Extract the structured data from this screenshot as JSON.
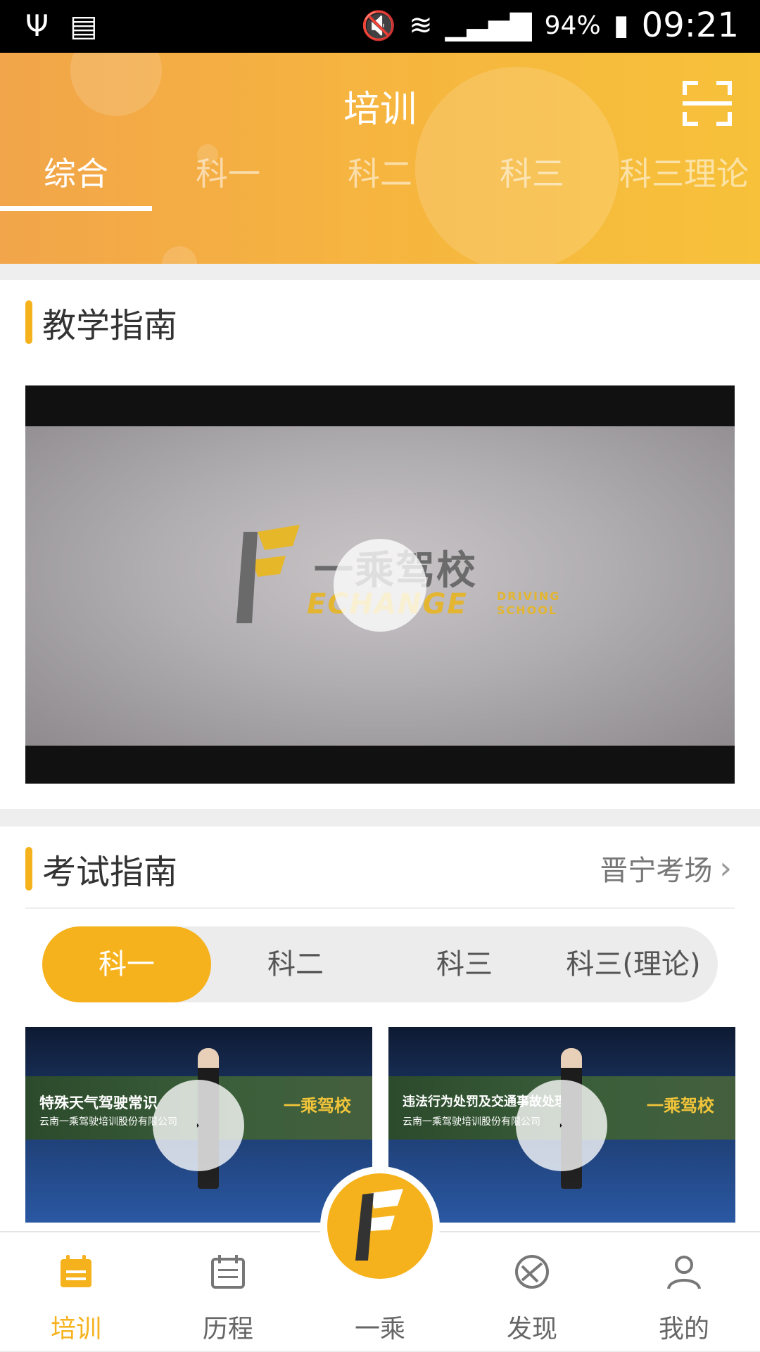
{
  "status_bar": {
    "battery": "94%",
    "time": "09:21"
  },
  "header": {
    "title": "培训"
  },
  "tabs": [
    {
      "label": "综合",
      "active": true
    },
    {
      "label": "科一",
      "active": false
    },
    {
      "label": "科二",
      "active": false
    },
    {
      "label": "科三",
      "active": false
    },
    {
      "label": "科三理论",
      "active": false
    }
  ],
  "teaching": {
    "title": "教学指南",
    "video": {
      "logo_cn": "一乘驾校",
      "logo_en": "ECHANGE",
      "logo_sub1": "DRIVING",
      "logo_sub2": "SCHOOL"
    }
  },
  "exam": {
    "title": "考试指南",
    "location": "晋宁考场",
    "segments": [
      {
        "label": "科一",
        "active": true
      },
      {
        "label": "科二",
        "active": false
      },
      {
        "label": "科三",
        "active": false
      },
      {
        "label": "科三(理论)",
        "active": false
      }
    ],
    "videos": [
      {
        "banner": "特殊天气驾驶常识",
        "sub": "云南一乘驾驶培训股份有限公司",
        "brand": "一乘驾校"
      },
      {
        "banner": "违法行为处罚及交通事故处理",
        "sub": "云南一乘驾驶培训股份有限公司",
        "brand": "一乘驾校"
      }
    ]
  },
  "bottom_nav": [
    {
      "label": "培训",
      "icon": "calendar-icon",
      "active": true
    },
    {
      "label": "历程",
      "icon": "history-icon",
      "active": false
    },
    {
      "label": "一乘",
      "icon": "brand-logo-icon",
      "active": false
    },
    {
      "label": "发现",
      "icon": "compass-icon",
      "active": false
    },
    {
      "label": "我的",
      "icon": "user-icon",
      "active": false
    }
  ],
  "colors": {
    "accent": "#f6b21c",
    "header_start": "#f2a54a",
    "header_end": "#f7c13a"
  }
}
